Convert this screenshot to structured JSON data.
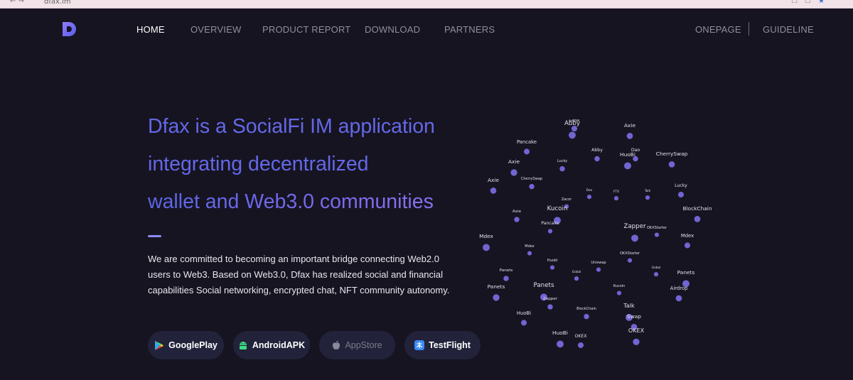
{
  "browser": {
    "url": "dfax.im"
  },
  "nav": {
    "items": [
      "HOME",
      "OVERVIEW",
      "PRODUCT REPORT",
      "DOWNLOAD",
      "PARTNERS"
    ],
    "right_items": [
      "ONEPAGE",
      "GUIDELINE"
    ]
  },
  "hero": {
    "headline": [
      "Dfax is a SocialFi IM application",
      "integrating decentralized",
      "wallet and Web3.0 communities"
    ],
    "description": "We are committed to becoming an important bridge connecting Web2.0 users to Web3. Based on Web3.0, Dfax has realized social and financial capabilities Social networking, encrypted chat, NFT community autonomy."
  },
  "downloads": [
    {
      "label": "GooglePlay",
      "icon": "google-play-icon",
      "enabled": true
    },
    {
      "label": "AndroidAPK",
      "icon": "android-icon",
      "enabled": true
    },
    {
      "label": "AppStore",
      "icon": "apple-icon",
      "enabled": false
    },
    {
      "label": "TestFlight",
      "icon": "testflight-icon",
      "enabled": true
    }
  ],
  "tag_cloud": [
    {
      "label": "Gobal"
    },
    {
      "label": "Abby"
    },
    {
      "label": "Axie"
    },
    {
      "label": "Pancake"
    },
    {
      "label": "Abby"
    },
    {
      "label": "Dao"
    },
    {
      "label": "HuoBi"
    },
    {
      "label": "CherrySwap"
    },
    {
      "label": "Lucky"
    },
    {
      "label": "Axie"
    },
    {
      "label": "CherrySwap"
    },
    {
      "label": "Axie"
    },
    {
      "label": "Lucky"
    },
    {
      "label": "Dex"
    },
    {
      "label": "FTX"
    },
    {
      "label": "Talk"
    },
    {
      "label": "Zacor"
    },
    {
      "label": "Axie"
    },
    {
      "label": "Kucoin"
    },
    {
      "label": "BlockChain"
    },
    {
      "label": "Mdex"
    },
    {
      "label": "Pancake"
    },
    {
      "label": "Zapper"
    },
    {
      "label": "OKXStarter"
    },
    {
      "label": "Mdex"
    },
    {
      "label": "Mdex"
    },
    {
      "label": "OKXStarter"
    },
    {
      "label": "Huobi"
    },
    {
      "label": "Uniswap"
    },
    {
      "label": "Panets"
    },
    {
      "label": "Gobal"
    },
    {
      "label": "Gobal"
    },
    {
      "label": "Panets"
    },
    {
      "label": "Panets"
    },
    {
      "label": "Panets"
    },
    {
      "label": "Kucoin"
    },
    {
      "label": "Airdrop"
    },
    {
      "label": "Zapper"
    },
    {
      "label": "Talk"
    },
    {
      "label": "BlockChain"
    },
    {
      "label": "HuoBi"
    },
    {
      "label": "Swap"
    },
    {
      "label": "HuoBi"
    },
    {
      "label": "OKEX"
    },
    {
      "label": "OKEX"
    }
  ],
  "colors": {
    "background": "#161421",
    "accent": "#6468e8",
    "bubble": "#7b6ee6",
    "button": "#22233a"
  }
}
